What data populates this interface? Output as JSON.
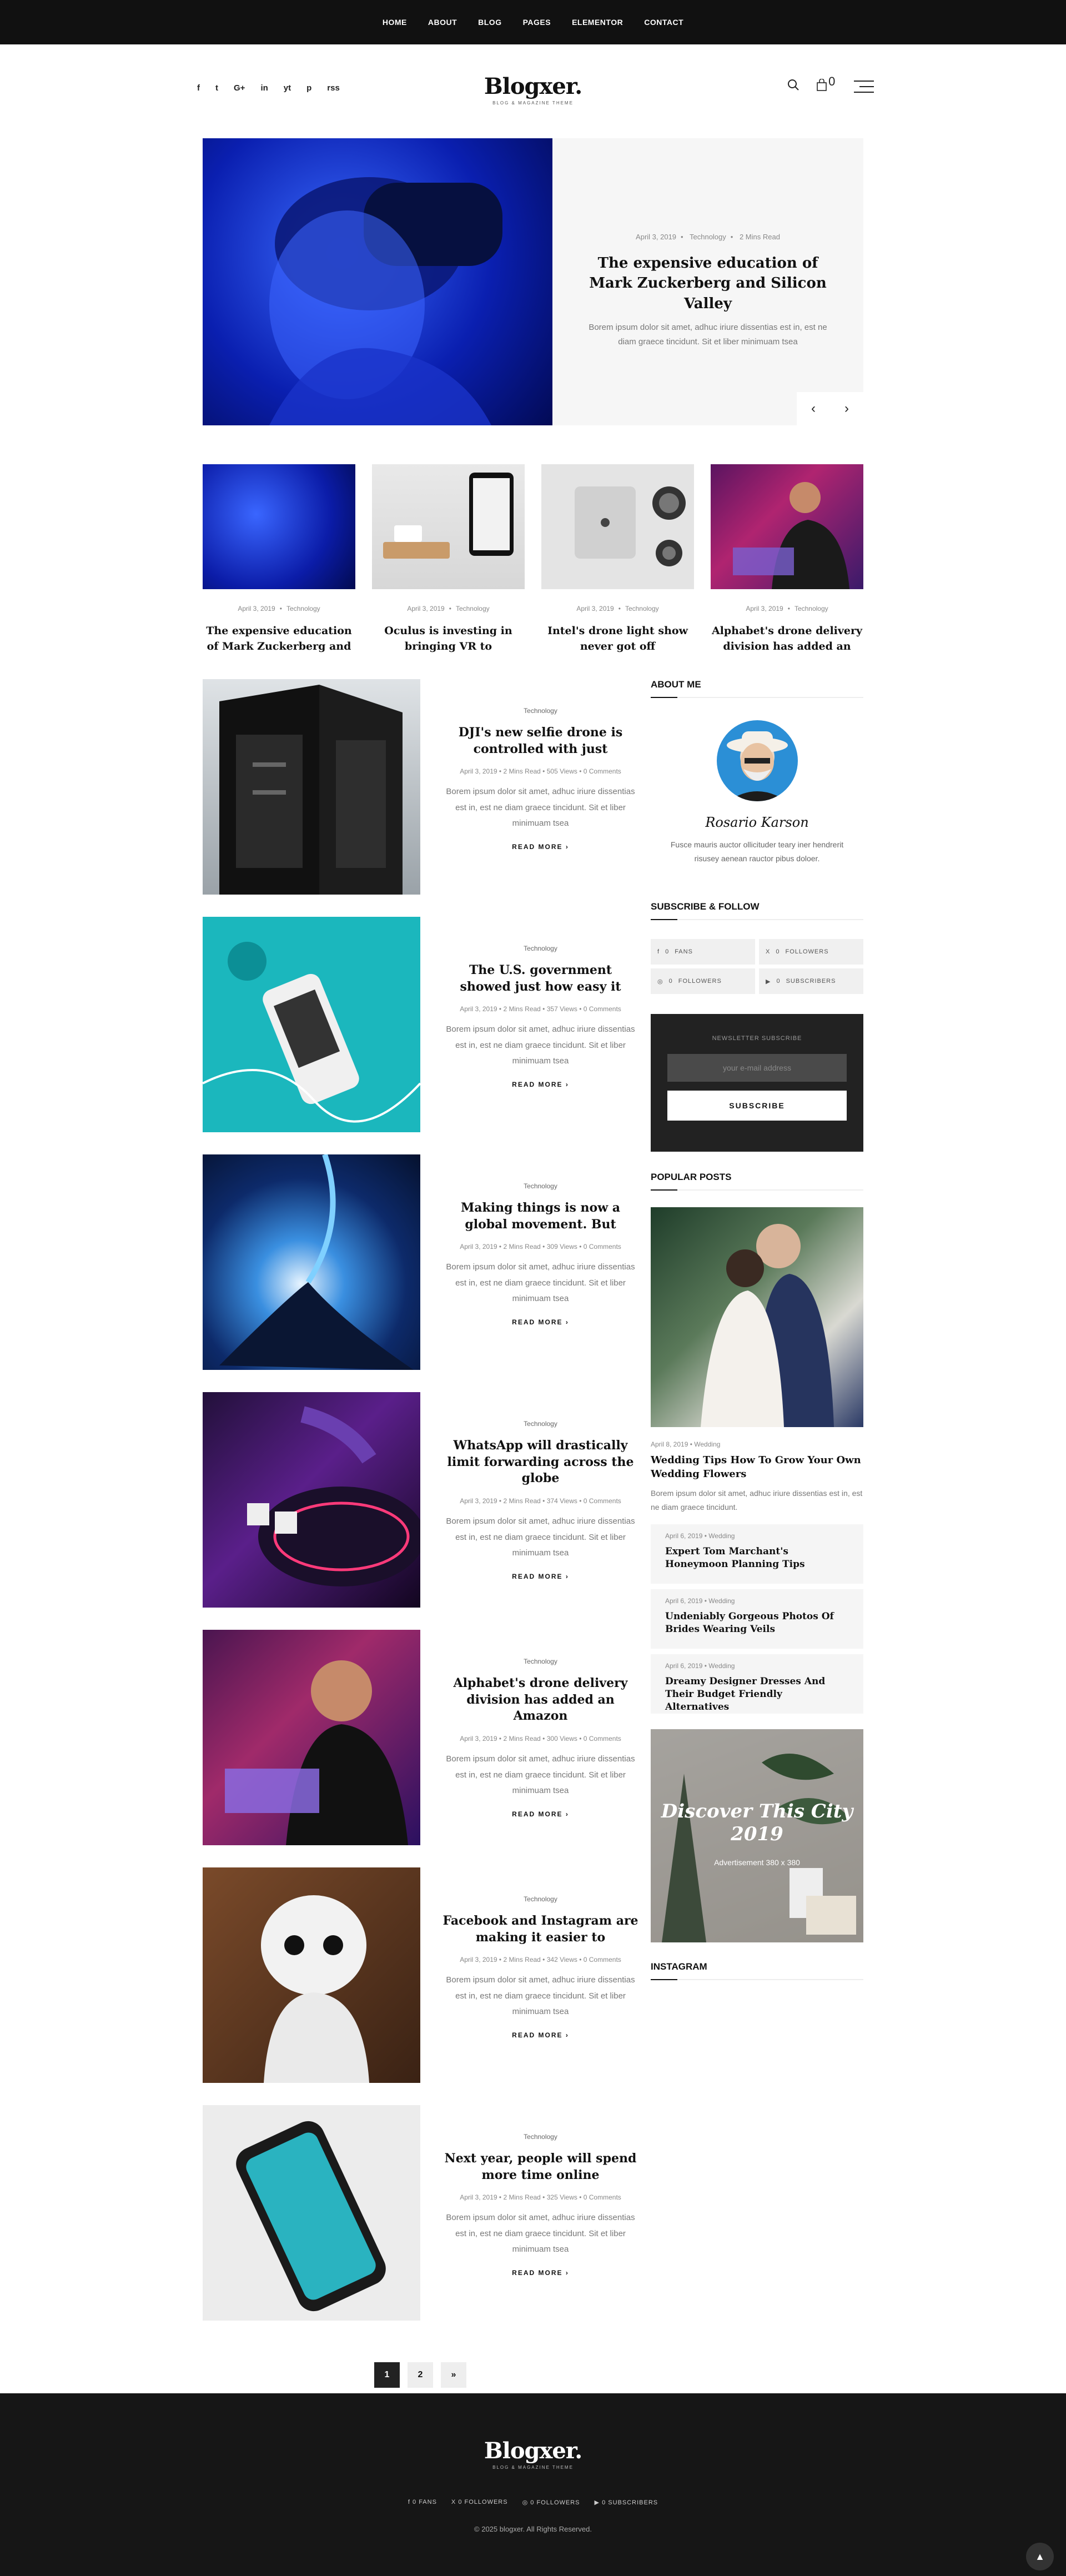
{
  "nav": {
    "items": [
      "HOME",
      "ABOUT",
      "BLOG",
      "PAGES",
      "ELEMENTOR",
      "CONTACT"
    ]
  },
  "header": {
    "socials": [
      "f",
      "t",
      "G+",
      "in",
      "yt",
      "p",
      "rss"
    ],
    "logo": "Blogxer.",
    "tagline": "BLOG & MAGAZINE THEME",
    "cart_count": "0"
  },
  "hero": {
    "date": "April 3, 2019",
    "category": "Technology",
    "read": "2 Mins Read",
    "title": "The expensive education of Mark Zuckerberg and Silicon Valley",
    "excerpt": "Borem ipsum dolor sit amet, adhuc iriure dissentias est in, est ne diam graece tincidunt. Sit et liber minimuam tsea",
    "prev": "‹",
    "next": "›"
  },
  "cards": [
    {
      "date": "April 3, 2019",
      "category": "Technology",
      "title": "The expensive education of Mark Zuckerberg and"
    },
    {
      "date": "April 3, 2019",
      "category": "Technology",
      "title": "Oculus is investing in bringing VR to"
    },
    {
      "date": "April 3, 2019",
      "category": "Technology",
      "title": "Intel's drone light show never got off"
    },
    {
      "date": "April 3, 2019",
      "category": "Technology",
      "title": "Alphabet's drone delivery division has added an"
    }
  ],
  "posts": [
    {
      "category": "Technology",
      "title": "DJI's new selfie drone is controlled with just",
      "date": "April 3, 2019",
      "read": "2 Mins Read",
      "views": "505 Views",
      "comments": "0 Comments",
      "excerpt": "Borem ipsum dolor sit amet, adhuc iriure dissentias est in, est ne diam graece tincidunt. Sit et liber minimuam tsea",
      "more": "READ MORE"
    },
    {
      "category": "Technology",
      "title": "The U.S. government showed just how easy it",
      "date": "April 3, 2019",
      "read": "2 Mins Read",
      "views": "357 Views",
      "comments": "0 Comments",
      "excerpt": "Borem ipsum dolor sit amet, adhuc iriure dissentias est in, est ne diam graece tincidunt. Sit et liber minimuam tsea",
      "more": "READ MORE"
    },
    {
      "category": "Technology",
      "title": "Making things is now a global movement. But",
      "date": "April 3, 2019",
      "read": "2 Mins Read",
      "views": "309 Views",
      "comments": "0 Comments",
      "excerpt": "Borem ipsum dolor sit amet, adhuc iriure dissentias est in, est ne diam graece tincidunt. Sit et liber minimuam tsea",
      "more": "READ MORE"
    },
    {
      "category": "Technology",
      "title": "WhatsApp will drastically limit forwarding across the globe",
      "date": "April 3, 2019",
      "read": "2 Mins Read",
      "views": "374 Views",
      "comments": "0 Comments",
      "excerpt": "Borem ipsum dolor sit amet, adhuc iriure dissentias est in, est ne diam graece tincidunt. Sit et liber minimuam tsea",
      "more": "READ MORE"
    },
    {
      "category": "Technology",
      "title": "Alphabet's drone delivery division has added an Amazon",
      "date": "April 3, 2019",
      "read": "2 Mins Read",
      "views": "300 Views",
      "comments": "0 Comments",
      "excerpt": "Borem ipsum dolor sit amet, adhuc iriure dissentias est in, est ne diam graece tincidunt. Sit et liber minimuam tsea",
      "more": "READ MORE"
    },
    {
      "category": "Technology",
      "title": "Facebook and Instagram are making it easier to",
      "date": "April 3, 2019",
      "read": "2 Mins Read",
      "views": "342 Views",
      "comments": "0 Comments",
      "excerpt": "Borem ipsum dolor sit amet, adhuc iriure dissentias est in, est ne diam graece tincidunt. Sit et liber minimuam tsea",
      "more": "READ MORE"
    },
    {
      "category": "Technology",
      "title": "Next year, people will spend more time online",
      "date": "April 3, 2019",
      "read": "2 Mins Read",
      "views": "325 Views",
      "comments": "0 Comments",
      "excerpt": "Borem ipsum dolor sit amet, adhuc iriure dissentias est in, est ne diam graece tincidunt. Sit et liber minimuam tsea",
      "more": "READ MORE"
    }
  ],
  "sidebar": {
    "about": {
      "heading": "ABOUT ME",
      "signature": "Rosario Karson",
      "text": "Fusce mauris auctor ollicituder teary iner hendrerit risusey aenean rauctor pibus doloer."
    },
    "follow": {
      "heading": "SUBSCRIBE & FOLLOW",
      "items": [
        {
          "icon": "f",
          "count": "0",
          "label": "FANS"
        },
        {
          "icon": "X",
          "count": "0",
          "label": "FOLLOWERS"
        },
        {
          "icon": "◎",
          "count": "0",
          "label": "FOLLOWERS"
        },
        {
          "icon": "▶",
          "count": "0",
          "label": "SUBSCRIBERS"
        }
      ]
    },
    "newsletter": {
      "label": "NEWSLETTER SUBSCRIBE",
      "placeholder": "your e-mail address",
      "button": "SUBSCRIBE"
    },
    "popular": {
      "heading": "POPULAR POSTS",
      "main": {
        "date": "April 8, 2019",
        "category": "Wedding",
        "title": "Wedding Tips How To Grow Your Own Wedding Flowers",
        "excerpt": "Borem ipsum dolor sit amet, adhuc iriure dissentias est in, est ne diam graece tincidunt."
      },
      "items": [
        {
          "date": "April 6, 2019",
          "category": "Wedding",
          "title": "Expert Tom Marchant's Honeymoon Planning Tips"
        },
        {
          "date": "April 6, 2019",
          "category": "Wedding",
          "title": "Undeniably Gorgeous Photos Of Brides Wearing Veils"
        },
        {
          "date": "April 6, 2019",
          "category": "Wedding",
          "title": "Dreamy Designer Dresses And Their Budget Friendly Alternatives"
        }
      ]
    },
    "ad": {
      "title": "Discover This City 2019",
      "sub": "Advertisement 380 x 380"
    },
    "instagram": {
      "heading": "INSTAGRAM"
    }
  },
  "pagination": {
    "pages": [
      "1",
      "2",
      "»"
    ]
  },
  "footer": {
    "logo": "Blogxer.",
    "tagline": "BLOG & MAGAZINE THEME",
    "socials": [
      {
        "icon": "f",
        "count": "0",
        "label": "FANS"
      },
      {
        "icon": "X",
        "count": "0",
        "label": "FOLLOWERS"
      },
      {
        "icon": "◎",
        "count": "0",
        "label": "FOLLOWERS"
      },
      {
        "icon": "▶",
        "count": "0",
        "label": "SUBSCRIBERS"
      }
    ],
    "copyright": "© 2025 blogxer. All Rights Reserved."
  }
}
